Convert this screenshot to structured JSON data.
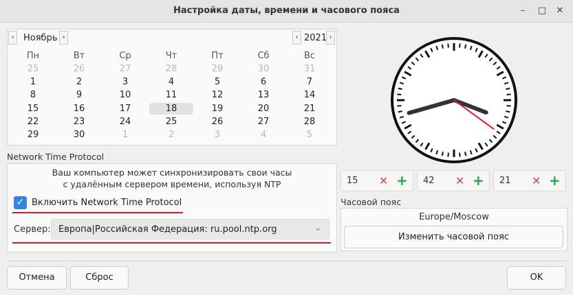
{
  "window": {
    "title": "Настройка даты, времени и часового пояса"
  },
  "calendar": {
    "month": "Ноябрь",
    "year": "2021",
    "weekdays": [
      "Пн",
      "Вт",
      "Ср",
      "Чт",
      "Пт",
      "Сб",
      "Вс"
    ],
    "weeks": [
      [
        "25",
        "26",
        "27",
        "28",
        "29",
        "30",
        "31"
      ],
      [
        "1",
        "2",
        "3",
        "4",
        "5",
        "6",
        "7"
      ],
      [
        "8",
        "9",
        "10",
        "11",
        "12",
        "13",
        "14"
      ],
      [
        "15",
        "16",
        "17",
        "18",
        "19",
        "20",
        "21"
      ],
      [
        "22",
        "23",
        "24",
        "25",
        "26",
        "27",
        "28"
      ],
      [
        "29",
        "30",
        "1",
        "2",
        "3",
        "4",
        "5"
      ]
    ],
    "selected": "18"
  },
  "ntp": {
    "section_title": "Network Time Protocol",
    "description_line1": "Ваш компьютер может синхронизировать свои часы",
    "description_line2": "с удалённым сервером времени, используя NTP",
    "enable_label": "Включить Network Time Protocol",
    "enabled": true,
    "server_label": "Сервер:",
    "server_value": "Европа|Российская Федерация: ru.pool.ntp.org"
  },
  "clock": {
    "hours": 15,
    "minutes": 42,
    "seconds": 21
  },
  "time_fields": {
    "hours": "15",
    "minutes": "42",
    "seconds": "21"
  },
  "timezone": {
    "section_title": "Часовой пояс",
    "value": "Europe/Moscow",
    "change_button": "Изменить часовой пояс"
  },
  "buttons": {
    "cancel": "Отмена",
    "reset": "Сброс",
    "ok": "OK"
  },
  "colors": {
    "accent": "#3584e4",
    "underline": "#d11a2a",
    "second_hand": "#e01b24",
    "plus": "#2fa14a",
    "clear": "#e04545"
  }
}
